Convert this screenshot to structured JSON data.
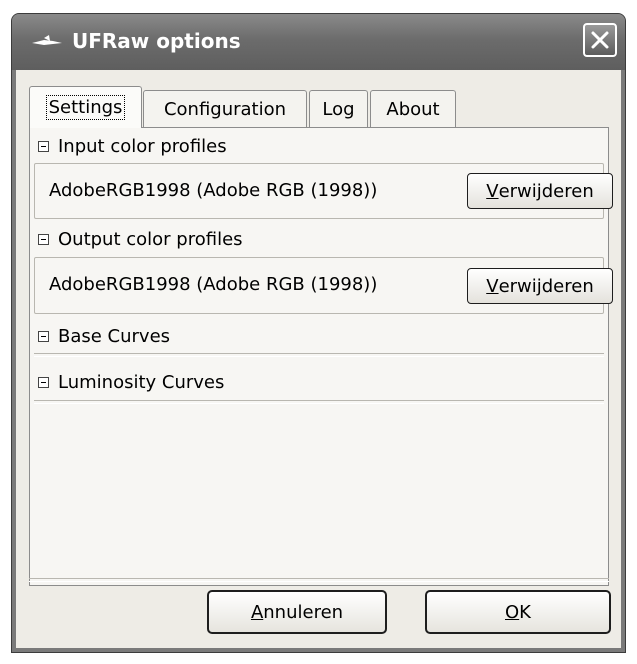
{
  "window": {
    "title": "UFRaw options",
    "app_icon": "ufraw-icon",
    "close_icon": "close-icon"
  },
  "tabs": [
    {
      "label": "Settings",
      "active": true
    },
    {
      "label": "Configuration",
      "active": false
    },
    {
      "label": "Log",
      "active": false
    },
    {
      "label": "About",
      "active": false
    }
  ],
  "sections": {
    "input": {
      "header": "Input color profiles",
      "profile": "AdobeRGB1998 (Adobe RGB (1998))",
      "remove_first": "V",
      "remove_rest": "erwijderen"
    },
    "output": {
      "header": "Output color profiles",
      "profile": "AdobeRGB1998 (Adobe RGB (1998))",
      "remove_first": "V",
      "remove_rest": "erwijderen"
    },
    "base_curves": {
      "header": "Base Curves"
    },
    "luminosity_curves": {
      "header": "Luminosity Curves"
    }
  },
  "buttons": {
    "cancel_first": "A",
    "cancel_rest": "nnuleren",
    "ok_first": "O",
    "ok_rest": "K"
  }
}
